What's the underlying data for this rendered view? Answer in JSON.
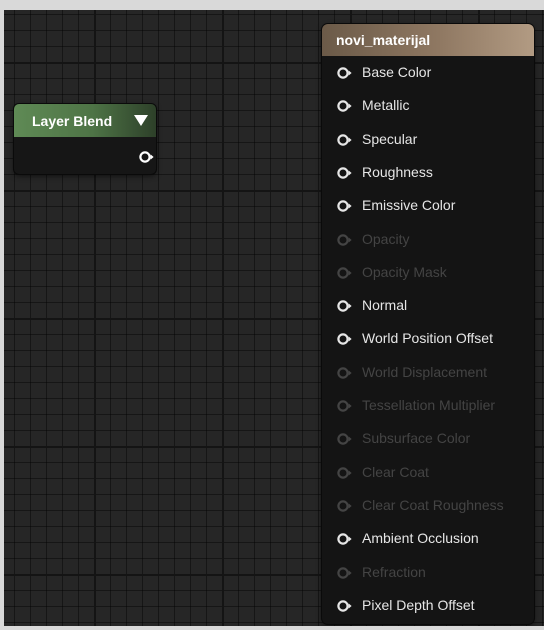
{
  "nodes": {
    "layer_blend": {
      "title": "Layer Blend"
    },
    "material": {
      "title": "novi_materijal",
      "pins": [
        {
          "label": "Base Color",
          "enabled": true
        },
        {
          "label": "Metallic",
          "enabled": true
        },
        {
          "label": "Specular",
          "enabled": true
        },
        {
          "label": "Roughness",
          "enabled": true
        },
        {
          "label": "Emissive Color",
          "enabled": true
        },
        {
          "label": "Opacity",
          "enabled": false
        },
        {
          "label": "Opacity Mask",
          "enabled": false
        },
        {
          "label": "Normal",
          "enabled": true
        },
        {
          "label": "World Position Offset",
          "enabled": true
        },
        {
          "label": "World Displacement",
          "enabled": false
        },
        {
          "label": "Tessellation Multiplier",
          "enabled": false
        },
        {
          "label": "Subsurface Color",
          "enabled": false
        },
        {
          "label": "Clear Coat",
          "enabled": false
        },
        {
          "label": "Clear Coat Roughness",
          "enabled": false
        },
        {
          "label": "Ambient Occlusion",
          "enabled": true
        },
        {
          "label": "Refraction",
          "enabled": false
        },
        {
          "label": "Pixel Depth Offset",
          "enabled": true
        }
      ]
    }
  },
  "colors": {
    "graph_background": "#262626",
    "layer_blend_header": "#5f8a55",
    "material_header": "#8f7862",
    "pin_enabled": "#e6e6e6",
    "pin_disabled": "#444444"
  },
  "icons": {
    "input_pin": "pin-connector-icon",
    "output_pin": "pin-connector-icon",
    "dropdown": "triangle-down-icon"
  }
}
